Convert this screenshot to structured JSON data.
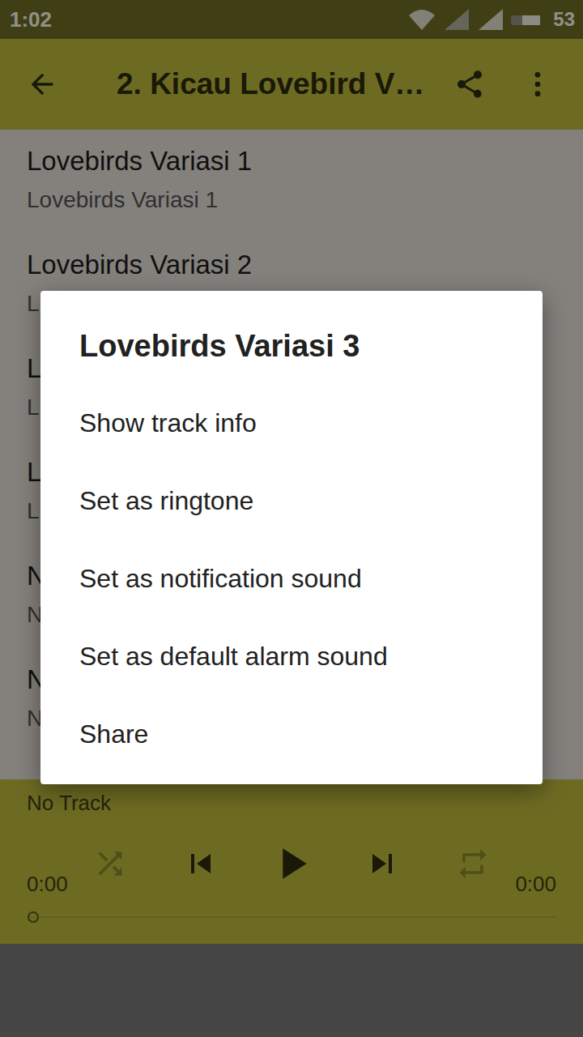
{
  "status_bar": {
    "time": "1:02",
    "battery": "53"
  },
  "app_bar": {
    "title": "2. Kicau Lovebird V…"
  },
  "tracks": [
    {
      "title": "Lovebirds Variasi 1",
      "subtitle": "Lovebirds Variasi 1"
    },
    {
      "title": "Lovebirds Variasi 2",
      "subtitle": "L"
    },
    {
      "title": "L",
      "subtitle": "L"
    },
    {
      "title": "L",
      "subtitle": "L"
    },
    {
      "title": "N",
      "subtitle": "N"
    },
    {
      "title": "N",
      "subtitle": "N"
    }
  ],
  "player": {
    "track": "No Track",
    "elapsed": "0:00",
    "duration": "0:00",
    "level": 0,
    "shuffle": false,
    "repeat": false
  },
  "dialog": {
    "title": "Lovebirds Variasi 3",
    "options": [
      "Show track info",
      "Set as ringtone",
      "Set as notification sound",
      "Set as default alarm sound",
      "Share"
    ]
  }
}
